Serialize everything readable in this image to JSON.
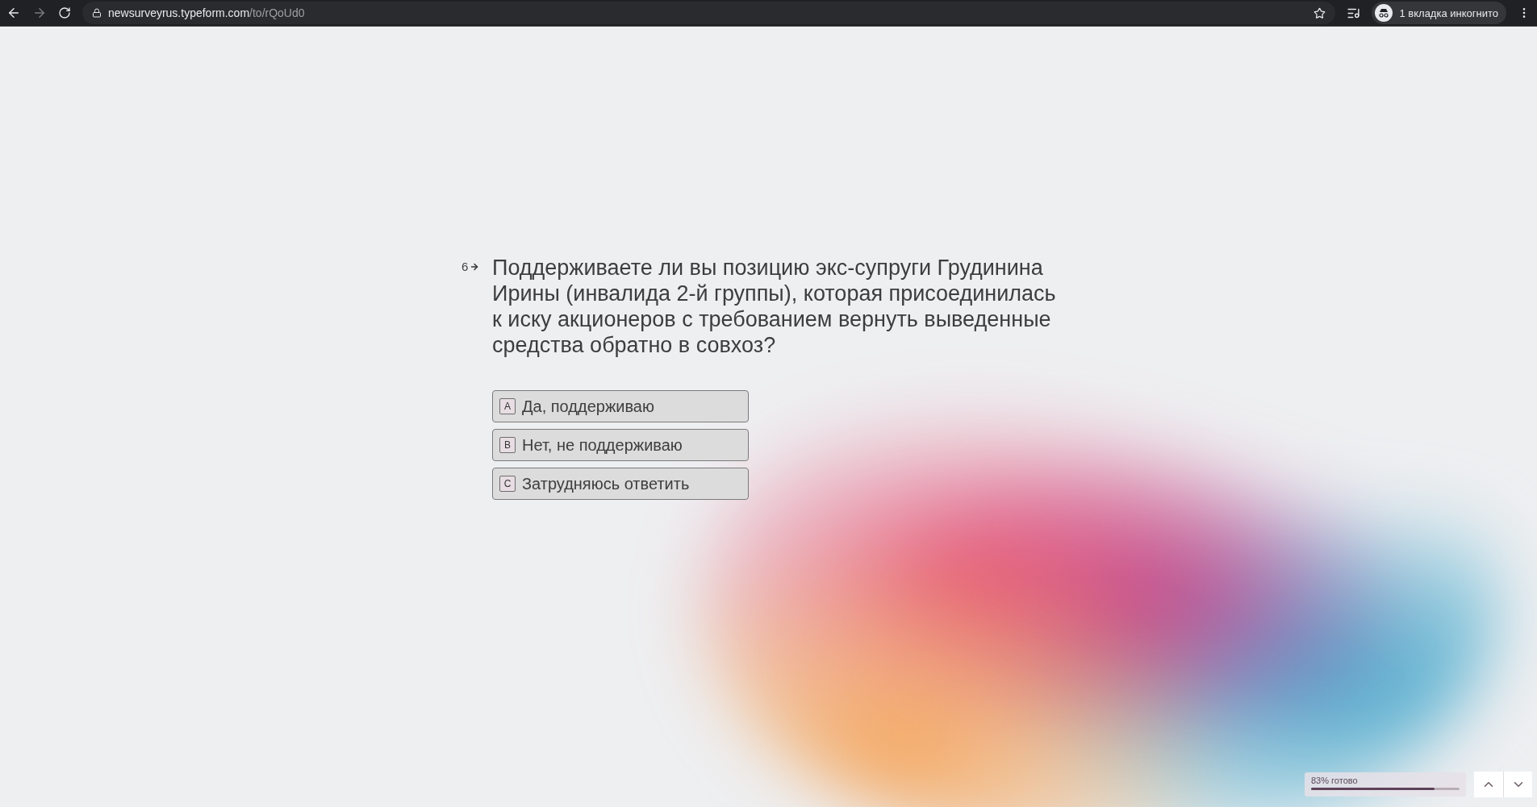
{
  "browser": {
    "url_host": "newsurveyrus.typeform.com",
    "url_path": "/to/rQoUd0",
    "incognito_label": "1 вкладка инкогнито"
  },
  "question": {
    "number": "6",
    "text": "Поддерживаете ли вы позицию экс-супруги Грудинина Ирины (инвалида 2-й группы), которая присоединилась к иску акционеров с требованием вернуть выведенные средства обратно в совхоз?"
  },
  "options": [
    {
      "key": "A",
      "label": "Да, поддерживаю",
      "selected": false
    },
    {
      "key": "B",
      "label": "Нет, не поддерживаю",
      "selected": false
    },
    {
      "key": "C",
      "label": "Затрудняюсь ответить",
      "selected": false
    }
  ],
  "progress": {
    "label": "83% готово",
    "level": 0.83
  }
}
